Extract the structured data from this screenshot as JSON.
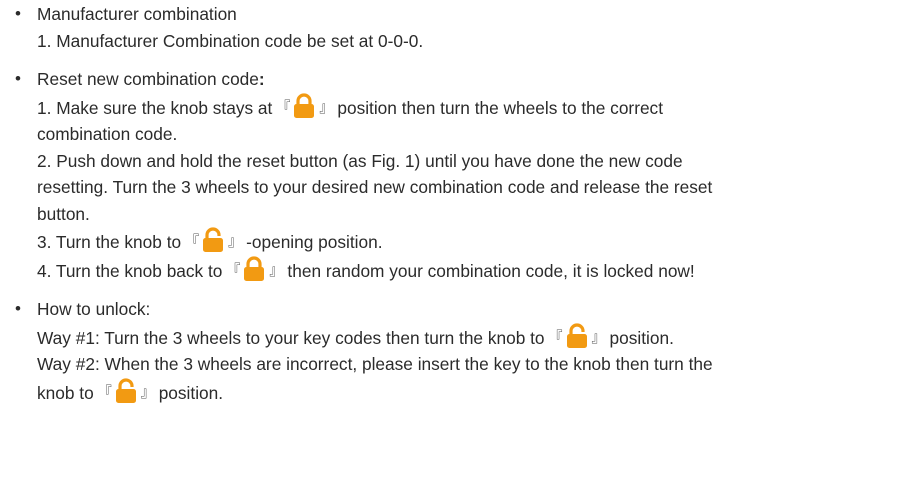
{
  "icons": {
    "locked": "padlock-closed-icon",
    "unlocked": "padlock-open-icon",
    "lock_color": "#F29A12"
  },
  "sections": {
    "manufacturer": {
      "heading": "Manufacturer combination",
      "item1": "1. Manufacturer Combination code be set at 0-0-0."
    },
    "reset": {
      "heading": "Reset new combination code",
      "heading_colon": ":",
      "step1_a": "1. Make sure the knob stays at",
      "step1_b": "position then turn the wheels to the correct",
      "step1_c": "combination code.",
      "step2_a": "2. Push down and hold the reset button (as Fig. 1) until you have done the new code",
      "step2_b": "resetting. Turn the 3 wheels to your desired new combination code and release the reset",
      "step2_c": "button.",
      "step3_a": "3. Turn the knob to",
      "step3_b": "-opening position.",
      "step4_a": "4. Turn the knob back to",
      "step4_b": "then random your combination code, it is locked now!"
    },
    "unlock": {
      "heading": "How to unlock:",
      "way1_a": "Way #1: Turn the 3 wheels to your key codes then turn the knob to",
      "way1_b": "position.",
      "way2_a": "Way #2: When the 3 wheels are incorrect, please insert the key to the knob then turn the",
      "way2_b": "knob to",
      "way2_c": "position."
    }
  },
  "glyphs": {
    "bullet": "•",
    "bracket_open": "『",
    "bracket_close": "』"
  }
}
